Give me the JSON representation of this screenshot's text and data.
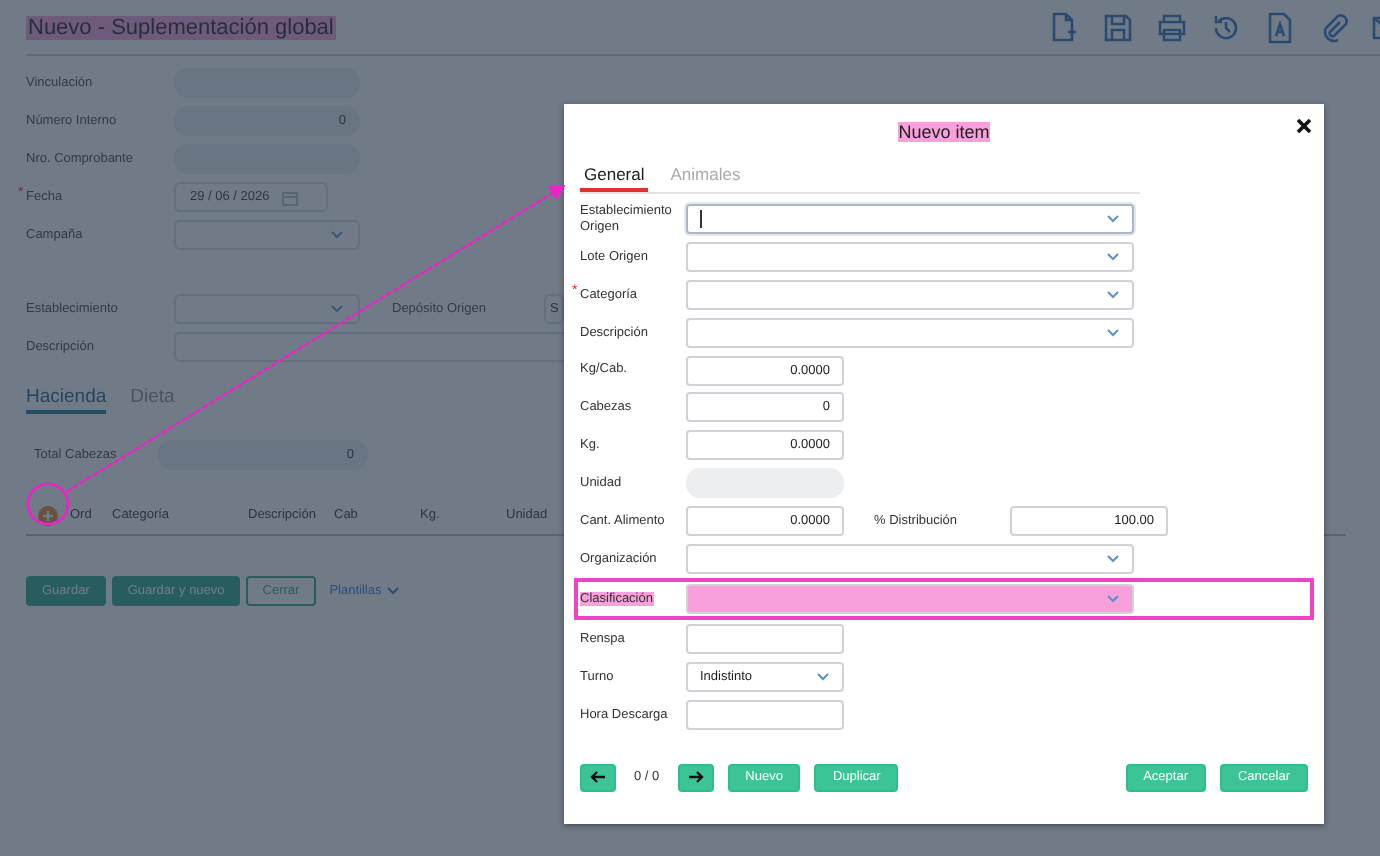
{
  "page": {
    "title": "Nuevo - Suplementación global",
    "title_highlighted": true,
    "fields": [
      {
        "label": "Vinculación",
        "kind": "text"
      },
      {
        "label": "Número Interno",
        "kind": "text",
        "value": "0"
      },
      {
        "label": "Nro. Comprobante",
        "kind": "text"
      },
      {
        "label": "Fecha",
        "kind": "date",
        "value": "29 / 06 / 2026",
        "required_mark": "*"
      },
      {
        "label": "Campaña",
        "kind": "select"
      }
    ],
    "fields2": [
      {
        "label": "Establecimiento",
        "kind": "select",
        "side": {
          "label": "Depósito Origen",
          "value": "S"
        }
      },
      {
        "label": "Descripción",
        "kind": "wide"
      }
    ],
    "tabs": [
      {
        "label": "Hacienda",
        "selected": true
      },
      {
        "label": "Dieta",
        "selected": false
      }
    ],
    "total": {
      "label": "Total Cabezas",
      "value": "0"
    },
    "table": {
      "columns": [
        "Ord",
        "Categoría",
        "Descripción",
        "Cab",
        "Kg.",
        "Unidad"
      ]
    },
    "buttons": [
      {
        "label": "Guardar",
        "kind": "primary"
      },
      {
        "label": "Guardar y nuevo",
        "kind": "primary"
      },
      {
        "label": "Cerrar",
        "kind": "outline"
      },
      {
        "label": "Plantillas",
        "kind": "link"
      }
    ]
  },
  "dialog": {
    "title": "Nuevo item",
    "title_highlighted": true,
    "tabs": [
      {
        "label": "General",
        "selected": true
      },
      {
        "label": "Animales",
        "selected": false
      }
    ],
    "rows": [
      {
        "label": "Establecimiento Origen",
        "kind": "select",
        "focused": true,
        "highlighted": false
      },
      {
        "label": "Lote Origen",
        "kind": "select",
        "focused": false,
        "highlighted": false
      },
      {
        "label": "Categoría",
        "kind": "select",
        "required_mark": "*",
        "focused": false,
        "highlighted": false
      },
      {
        "label": "Descripción",
        "kind": "select",
        "focused": false,
        "highlighted": false
      },
      {
        "label": "Kg/Cab.",
        "kind": "number",
        "value": "0.0000",
        "highlighted": false
      },
      {
        "label": "Cabezas",
        "kind": "number",
        "value": "0",
        "highlighted": false
      },
      {
        "label": "Kg.",
        "kind": "number",
        "value": "0.0000",
        "highlighted": false
      },
      {
        "label": "Unidad",
        "kind": "readonly",
        "highlighted": false
      },
      {
        "label": "Cant. Alimento",
        "kind": "number",
        "value": "0.0000",
        "highlighted": false,
        "side": {
          "label": "% Distribución",
          "value": "100.00"
        }
      },
      {
        "label": "Organización",
        "kind": "select",
        "focused": false,
        "highlighted": false
      },
      {
        "label": "Clasificación",
        "kind": "select",
        "focused": false,
        "highlighted": true
      },
      {
        "label": "Renspa",
        "kind": "number",
        "highlighted": false
      },
      {
        "label": "Turno",
        "kind": "smallselect",
        "value": "Indistinto",
        "highlighted": false
      },
      {
        "label": "Hora Descarga",
        "kind": "number",
        "highlighted": false
      }
    ],
    "pager": "0 / 0",
    "left_buttons": [
      "Nuevo",
      "Duplicar"
    ],
    "right_buttons": [
      "Aceptar",
      "Cancelar"
    ]
  }
}
